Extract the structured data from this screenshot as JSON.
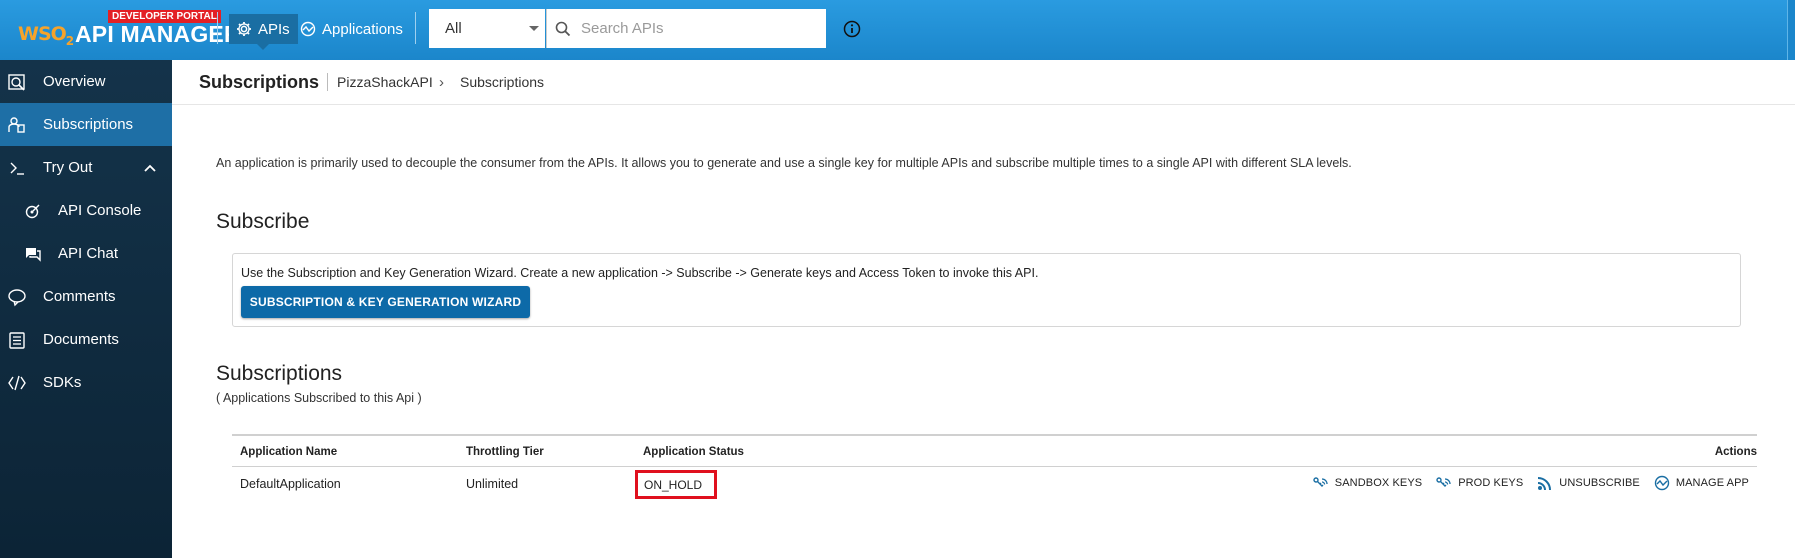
{
  "header": {
    "logo_wso2": "WSO",
    "logo_sub": "2",
    "logo_title": "API MANAGER",
    "badge": "DEVELOPER PORTAL",
    "nav": [
      {
        "label": "APIs",
        "icon": "gear-icon",
        "active": true
      },
      {
        "label": "Applications",
        "icon": "applications-icon",
        "active": false
      }
    ],
    "search": {
      "scope": "All",
      "placeholder": "Search APIs"
    }
  },
  "sidebar": {
    "items": [
      {
        "label": "Overview",
        "icon": "overview-icon"
      },
      {
        "label": "Subscriptions",
        "icon": "subscriptions-icon"
      },
      {
        "label": "Try Out",
        "icon": "terminal-icon"
      },
      {
        "label": "API Console",
        "icon": "api-console-icon"
      },
      {
        "label": "API Chat",
        "icon": "chat-icon"
      },
      {
        "label": "Comments",
        "icon": "comments-icon"
      },
      {
        "label": "Documents",
        "icon": "documents-icon"
      },
      {
        "label": "SDKs",
        "icon": "code-icon"
      }
    ]
  },
  "breadcrumb": {
    "title": "Subscriptions",
    "api": "PizzaShackAPI",
    "current": "Subscriptions"
  },
  "main": {
    "intro": "An application is primarily used to decouple the consumer from the APIs. It allows you to generate and use a single key for multiple APIs and subscribe multiple times to a single API with different SLA levels.",
    "subscribe_heading": "Subscribe",
    "wizard_text": "Use the Subscription and Key Generation Wizard. Create a new application -> Subscribe -> Generate keys and Access Token to invoke this API.",
    "wizard_button": "SUBSCRIPTION & KEY GENERATION WIZARD",
    "subscriptions_heading": "Subscriptions",
    "subscriptions_note": "( Applications Subscribed to this Api )"
  },
  "table": {
    "headers": {
      "name": "Application Name",
      "tier": "Throttling Tier",
      "status": "Application Status",
      "actions": "Actions"
    },
    "rows": [
      {
        "name": "DefaultApplication",
        "tier": "Unlimited",
        "status": "ON_HOLD",
        "actions": [
          {
            "label": "SANDBOX KEYS",
            "icon": "sandbox-keys-icon"
          },
          {
            "label": "PROD KEYS",
            "icon": "prod-keys-icon"
          },
          {
            "label": "UNSUBSCRIBE",
            "icon": "unsubscribe-icon"
          },
          {
            "label": "MANAGE APP",
            "icon": "manage-app-icon"
          }
        ]
      }
    ]
  },
  "colors": {
    "topbar": "#1f8fd3",
    "sidebar": "#0f2c40",
    "sidebar_active": "#1e6fa6",
    "button": "#0d6aa8",
    "highlight": "#e0101e"
  }
}
